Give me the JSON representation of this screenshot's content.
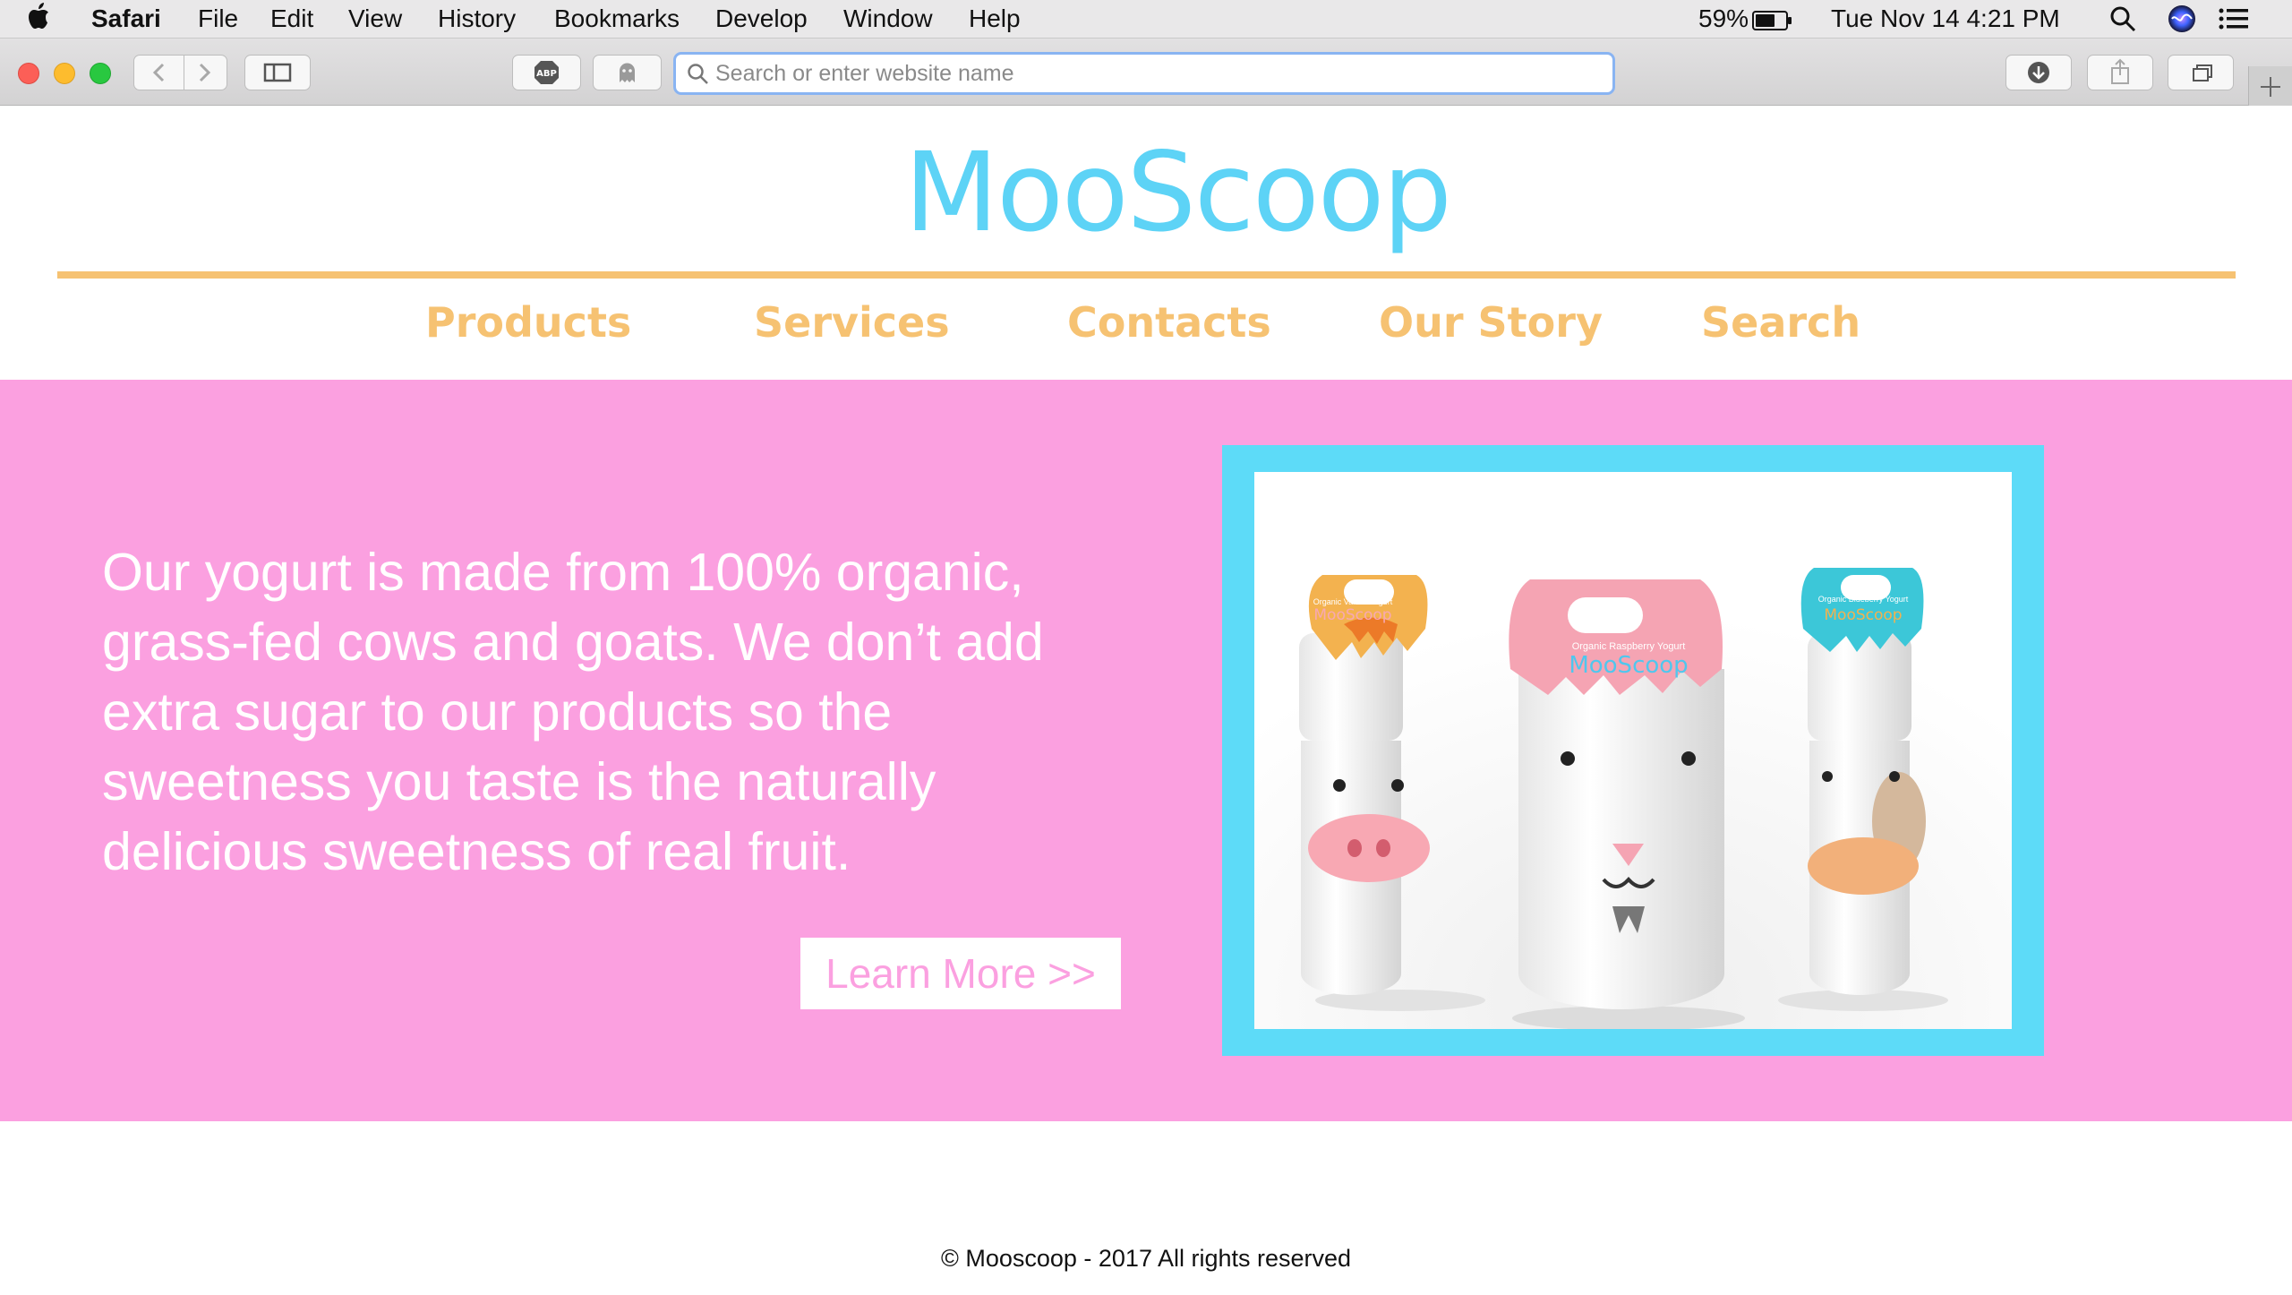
{
  "menubar": {
    "app_name": "Safari",
    "menus": [
      "File",
      "Edit",
      "View",
      "History",
      "Bookmarks",
      "Develop",
      "Window",
      "Help"
    ],
    "battery": "59%",
    "clock": "Tue Nov 14  4:21 PM"
  },
  "toolbar": {
    "adblock_label": "ABP",
    "url_placeholder": "Search or enter website name",
    "url_value": ""
  },
  "site": {
    "logo": "MooScoop",
    "nav": [
      "Products",
      "Services",
      "Contacts",
      "Our Story",
      "Search"
    ],
    "hero": {
      "text": "Our yogurt is made from 100% organic, grass-fed cows and goats. We don’t add extra sugar to our products so the sweetness you taste is the naturally delicious sweetness of real fruit.",
      "button": "Learn More >>"
    },
    "product_image": {
      "products": [
        {
          "label": "Organic Vanilla Yogurt",
          "brand": "MooScoop"
        },
        {
          "label": "Organic Raspberry Yogurt",
          "brand": "MooScoop"
        },
        {
          "label": "Organic Blueberry Yogurt",
          "brand": "MooScoop"
        }
      ]
    },
    "footer": "© Mooscoop - 2017 All rights reserved"
  },
  "colors": {
    "brand_blue": "#5dd3f6",
    "nav_orange": "#f6c272",
    "hero_pink": "#fba0e0",
    "frame_blue": "#5ddbf8"
  },
  "icons": [
    "apple-icon",
    "back-icon",
    "forward-icon",
    "sidebar-icon",
    "adblock-icon",
    "ghostery-icon",
    "search-icon",
    "download-icon",
    "share-icon",
    "tabs-icon",
    "new-tab-icon",
    "battery-icon",
    "spotlight-icon",
    "siri-icon",
    "notification-center-icon"
  ]
}
